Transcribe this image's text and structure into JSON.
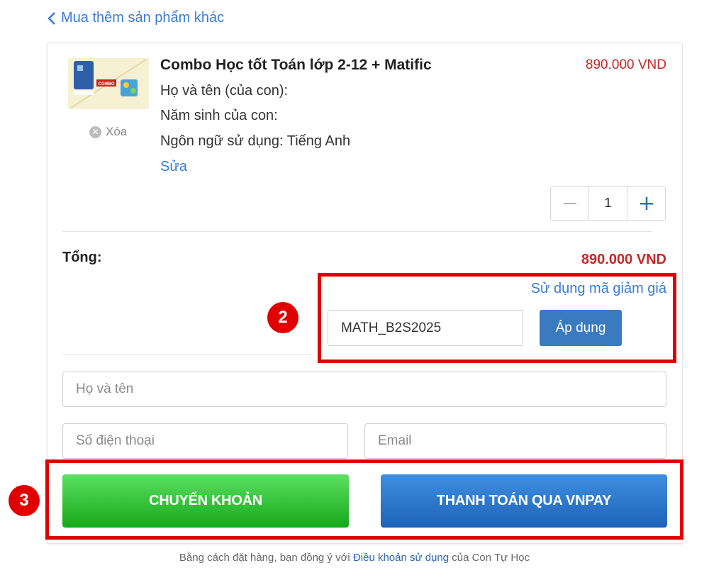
{
  "nav": {
    "back_label": "Mua thêm sản phẩm khác"
  },
  "product": {
    "thumb_badge": "COMBO",
    "remove_label": "Xóa",
    "name": "Combo Học tốt Toán lớp 2-12 + Matific",
    "price": "890.000 VND",
    "child_name_label": "Họ và tên (của con):",
    "birth_year_label": "Năm sinh của con:",
    "language_label": "Ngôn ngữ sử dụng: Tiếng Anh",
    "edit_label": "Sửa",
    "quantity": "1"
  },
  "summary": {
    "total_label": "Tổng:",
    "total_value": "890.000 VND"
  },
  "coupon": {
    "link_label": "Sử dụng mã giảm giá",
    "code_value": "MATH_B2S2025",
    "apply_label": "Áp dụng"
  },
  "annotations": {
    "coupon_step": "2",
    "payment_step": "3"
  },
  "form": {
    "fullname_placeholder": "Họ và tên",
    "phone_placeholder": "Số điện thoại",
    "email_placeholder": "Email"
  },
  "payment": {
    "transfer_label": "CHUYỂN KHOẢN",
    "vnpay_label": "THANH TOÁN QUA VNPAY"
  },
  "footer": {
    "prefix": "Bằng cách đặt hàng, bạn đồng ý với ",
    "terms_label": "Điều khoản sử dụng",
    "suffix": " của Con Tự Học"
  },
  "colors": {
    "accent": "#3a7bd5",
    "price": "#c62828",
    "highlight": "#e00000",
    "transfer": "#14a81a",
    "vnpay": "#1e63b8"
  }
}
